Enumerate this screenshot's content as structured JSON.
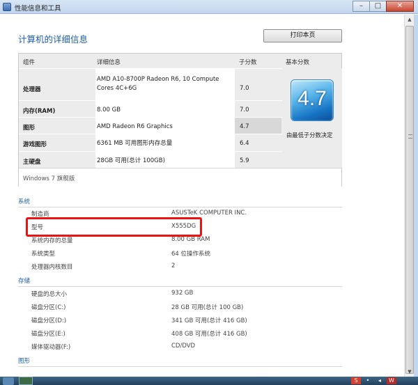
{
  "window": {
    "title": "性能信息和工具",
    "controls": [
      "minimize",
      "maximize",
      "close"
    ]
  },
  "page": {
    "heading": "计算机的详细信息",
    "print_label": "打印本页"
  },
  "summary": {
    "headers": {
      "component": "组件",
      "detail": "详细信息",
      "subscore": "子分数",
      "base": "基本分数"
    },
    "rows": [
      {
        "component": "处理器",
        "detail": "AMD A10-8700P Radeon R6, 10 Compute Cores 4C+6G",
        "subscore": "7.0"
      },
      {
        "component": "内存(RAM)",
        "detail": "8.00 GB",
        "subscore": "7.0"
      },
      {
        "component": "图形",
        "detail": "AMD Radeon R6 Graphics",
        "subscore": "4.7"
      },
      {
        "component": "游戏图形",
        "detail": "6361 MB 可用图形内存总量",
        "subscore": "6.4"
      },
      {
        "component": "主硬盘",
        "detail": "28GB 可用(总计 100GB)",
        "subscore": "5.9"
      }
    ],
    "base_score": "4.7",
    "base_note": "由最低子分数决定",
    "windows_edition": "Windows 7 旗舰版"
  },
  "system": {
    "section_title": "系统",
    "items": [
      {
        "key": "制造商",
        "value": "ASUSTeK COMPUTER INC."
      },
      {
        "key": "型号",
        "value": "X555DG"
      },
      {
        "key": "系统内存的总量",
        "value": "8.00 GB RAM"
      },
      {
        "key": "系统类型",
        "value": "64 位操作系统"
      },
      {
        "key": "处理器内核数目",
        "value": "2"
      }
    ]
  },
  "storage": {
    "section_title": "存储",
    "items": [
      {
        "key": "硬盘的总大小",
        "value": "932 GB"
      },
      {
        "key": "磁盘分区(C:)",
        "value": "28 GB 可用(总计 100 GB)"
      },
      {
        "key": "磁盘分区(D:)",
        "value": "341 GB 可用(总计 416 GB)"
      },
      {
        "key": "磁盘分区(E:)",
        "value": "408 GB 可用(总计 416 GB)"
      },
      {
        "key": "媒体驱动器(F:)",
        "value": "CD/DVD"
      }
    ]
  },
  "graphics": {
    "section_title": "图形"
  },
  "colors": {
    "accent": "#1e5fa8",
    "highlight": "#ee1111"
  }
}
